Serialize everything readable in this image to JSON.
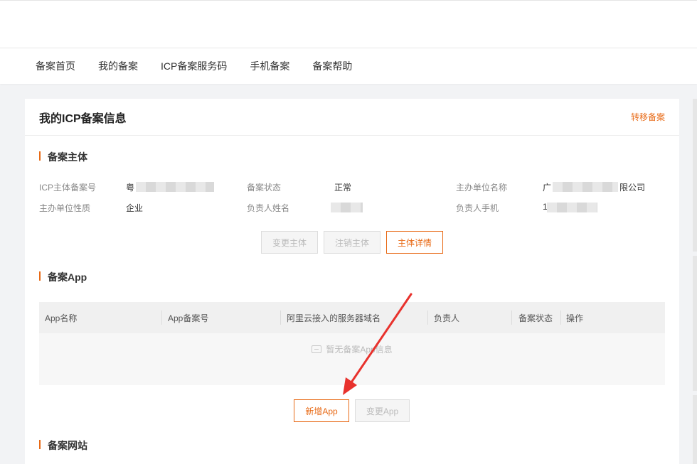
{
  "nav": {
    "items": [
      "备案首页",
      "我的备案",
      "ICP备案服务码",
      "手机备案",
      "备案帮助"
    ]
  },
  "card": {
    "title": "我的ICP备案信息",
    "transfer_link": "转移备案"
  },
  "subject": {
    "section_title": "备案主体",
    "fields": {
      "icp_number": {
        "label": "ICP主体备案号",
        "value": "粤"
      },
      "status": {
        "label": "备案状态",
        "value": "正常"
      },
      "org_name": {
        "label": "主办单位名称",
        "value_prefix": "广",
        "value_suffix": "限公司"
      },
      "org_nature": {
        "label": "主办单位性质",
        "value": "企业"
      },
      "person_name": {
        "label": "负责人姓名",
        "value": ""
      },
      "person_phone": {
        "label": "负责人手机",
        "value": "1"
      }
    },
    "buttons": {
      "change": "变更主体",
      "cancel": "注销主体",
      "detail": "主体详情"
    }
  },
  "app": {
    "section_title": "备案App",
    "columns": [
      "App名称",
      "App备案号",
      "阿里云接入的服务器域名",
      "负责人",
      "备案状态",
      "操作"
    ],
    "empty_text": "暂无备案App信息",
    "buttons": {
      "add": "新增App",
      "change": "变更App"
    }
  },
  "website": {
    "section_title": "备案网站"
  },
  "colors": {
    "accent": "#e86a16",
    "annotation_arrow": "#e8322d"
  }
}
